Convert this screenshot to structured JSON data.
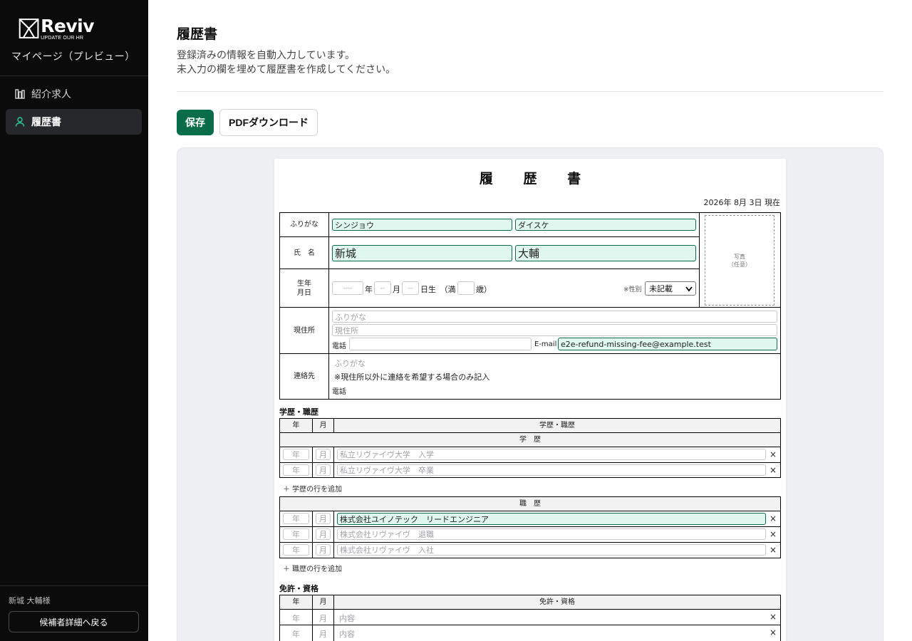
{
  "brand": {
    "name": "Reviv",
    "tagline": "UPDATE OUR HR"
  },
  "sidebar": {
    "title": "マイページ（プレビュー）",
    "items": [
      {
        "label": "紹介求人",
        "icon": "building-icon",
        "active": false
      },
      {
        "label": "履歴書",
        "icon": "user-icon",
        "active": true
      }
    ],
    "user": "新城 大輔様",
    "back_button": "候補者詳細へ戻る"
  },
  "main": {
    "title": "履歴書",
    "description_line1": "登録済みの情報を自動入力しています。",
    "description_line2": "未入力の欄を埋めて履歴書を作成してください。",
    "save_button": "保存",
    "pdf_button": "PDFダウンロード"
  },
  "resume": {
    "title": "履 歴 書",
    "date": "2026年 8月 3日 現在",
    "furigana_label": "ふりがな",
    "name_label": "氏　名",
    "furigana_last": "シンジョウ",
    "furigana_first": "ダイスケ",
    "name_last": "新城",
    "name_first": "大輔",
    "birth_label_1": "生年",
    "birth_label_2": "月日",
    "birth_year_ph": "----",
    "birth_year_unit": "年",
    "birth_month_ph": "--",
    "birth_month_unit": "月",
    "birth_day_ph": "--",
    "birth_day_unit": "日生　（満",
    "age_unit": "歳）",
    "gender_label": "※性別",
    "gender_value": "未記載",
    "photo_line1": "写真",
    "photo_line2": "（任意）",
    "address_label": "現住所",
    "address_furigana_ph": "ふりがな",
    "address_ph": "現住所",
    "phone_label": "電話",
    "email_label": "E-mail",
    "email_value": "e2e-refund-missing-fee@example.test",
    "contact_label": "連絡先",
    "contact_furigana_ph": "ふりがな",
    "contact_note": "※現住所以外に連絡を希望する場合のみ記入",
    "contact_phone_label": "電話",
    "history_section": "学歴・職歴",
    "col_year": "年",
    "col_month": "月",
    "col_history": "学歴・職歴",
    "education_header": "学　歴",
    "education_rows": [
      {
        "year_ph": "年",
        "month_ph": "月",
        "content_ph": "私立リヴァイヴ大学　入学",
        "content": ""
      },
      {
        "year_ph": "年",
        "month_ph": "月",
        "content_ph": "私立リヴァイヴ大学　卒業",
        "content": ""
      }
    ],
    "add_education": "＋ 学歴の行を追加",
    "work_header": "職　歴",
    "work_rows": [
      {
        "year_ph": "年",
        "month_ph": "月",
        "content_ph": "",
        "content": "株式会社ユイノテック　リードエンジニア"
      },
      {
        "year_ph": "年",
        "month_ph": "月",
        "content_ph": "株式会社リヴァイヴ　退職",
        "content": ""
      },
      {
        "year_ph": "年",
        "month_ph": "月",
        "content_ph": "株式会社リヴァイヴ　入社",
        "content": ""
      }
    ],
    "add_work": "＋ 職歴の行を追加",
    "license_section": "免許・資格",
    "col_license": "免許・資格",
    "license_rows": [
      {
        "year_ph": "年",
        "month_ph": "月",
        "content_ph": "内容"
      },
      {
        "year_ph": "年",
        "month_ph": "月",
        "content_ph": "内容"
      }
    ],
    "remove_symbol": "×"
  }
}
